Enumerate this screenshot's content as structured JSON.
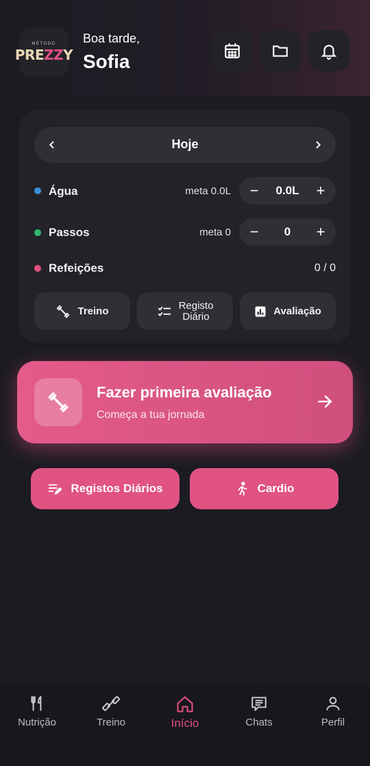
{
  "header": {
    "greeting": "Boa tarde,",
    "user_name": "Sofia",
    "logo_small": "MÉTODO",
    "logo_main_a": "PRE",
    "logo_main_z": "ZZ",
    "logo_main_b": "Y",
    "icons": [
      "calendar-icon",
      "folder-icon",
      "bell-icon"
    ]
  },
  "day_nav": {
    "label": "Hoje"
  },
  "metrics": {
    "water": {
      "label": "Água",
      "meta": "meta 0.0L",
      "value": "0.0L",
      "color": "#3b8fd6"
    },
    "steps": {
      "label": "Passos",
      "meta": "meta 0",
      "value": "0",
      "color": "#2fb86b"
    },
    "meals": {
      "label": "Refeições",
      "count": "0 / 0",
      "color": "#e0507f"
    }
  },
  "quick_actions": {
    "workout": "Treino",
    "daily_log_line1": "Registo",
    "daily_log_line2": "Diário",
    "assessment": "Avaliação"
  },
  "assessment_card": {
    "title": "Fazer primeira avaliação",
    "subtitle": "Começa a tua jornada"
  },
  "primary_buttons": {
    "daily_logs": "Registos Diários",
    "cardio": "Cardio"
  },
  "bottom_nav": {
    "nutrition": "Nutrição",
    "workout": "Treino",
    "home": "Início",
    "chats": "Chats",
    "profile": "Perfil",
    "active": "home",
    "accent": "#e0507f"
  }
}
